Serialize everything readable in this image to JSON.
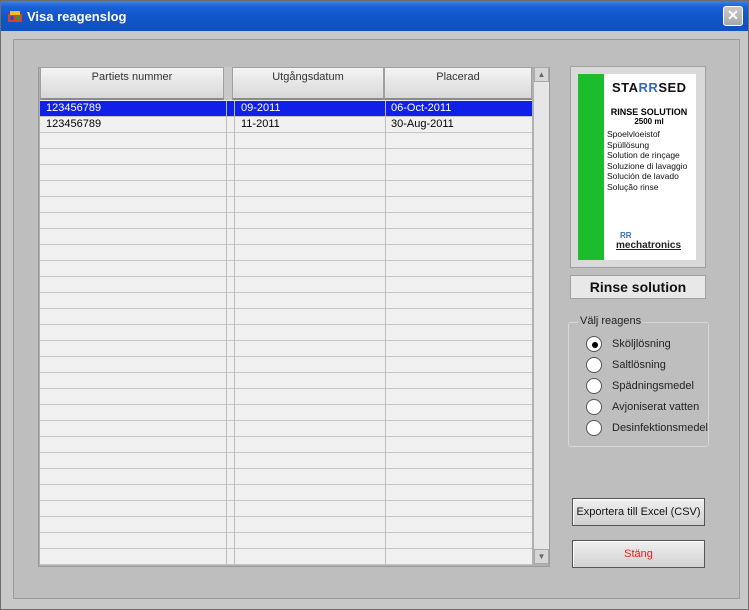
{
  "window": {
    "title": "Visa reagenslog",
    "close_glyph": "✕"
  },
  "table": {
    "columns": [
      "Partiets nummer",
      "Utgångsdatum",
      "Placerad"
    ],
    "rows": [
      [
        "123456789",
        "09-2011",
        "06-Oct-2011"
      ],
      [
        "123456789",
        "11-2011",
        "30-Aug-2011"
      ]
    ],
    "selected_row": 0,
    "selection_color": "#1020e8"
  },
  "product": {
    "brand_left": "STA",
    "brand_rr": "RR",
    "brand_right": "SED",
    "name": "RINSE SOLUTION",
    "volume": "2500 ml",
    "languages": [
      "Spoelvloeistof",
      "Spüllösung",
      "Solution de rinçage",
      "Soluzione di lavaggio",
      "Solución de lavado",
      "Solução rinse"
    ],
    "maker_logo": "RR",
    "maker": "mechatronics",
    "stripe_color": "#1bbd2d"
  },
  "reagent_label": "Rinse solution",
  "reagent_group": {
    "title": "Välj reagens",
    "options": [
      "Sköljlösning",
      "Saltlösning",
      "Spädningsmedel",
      "Avjoniserat vatten",
      "Desinfektionsmedel"
    ],
    "selected": 0
  },
  "buttons": {
    "export": "Exportera till Excel (CSV)",
    "close": "Stäng"
  }
}
